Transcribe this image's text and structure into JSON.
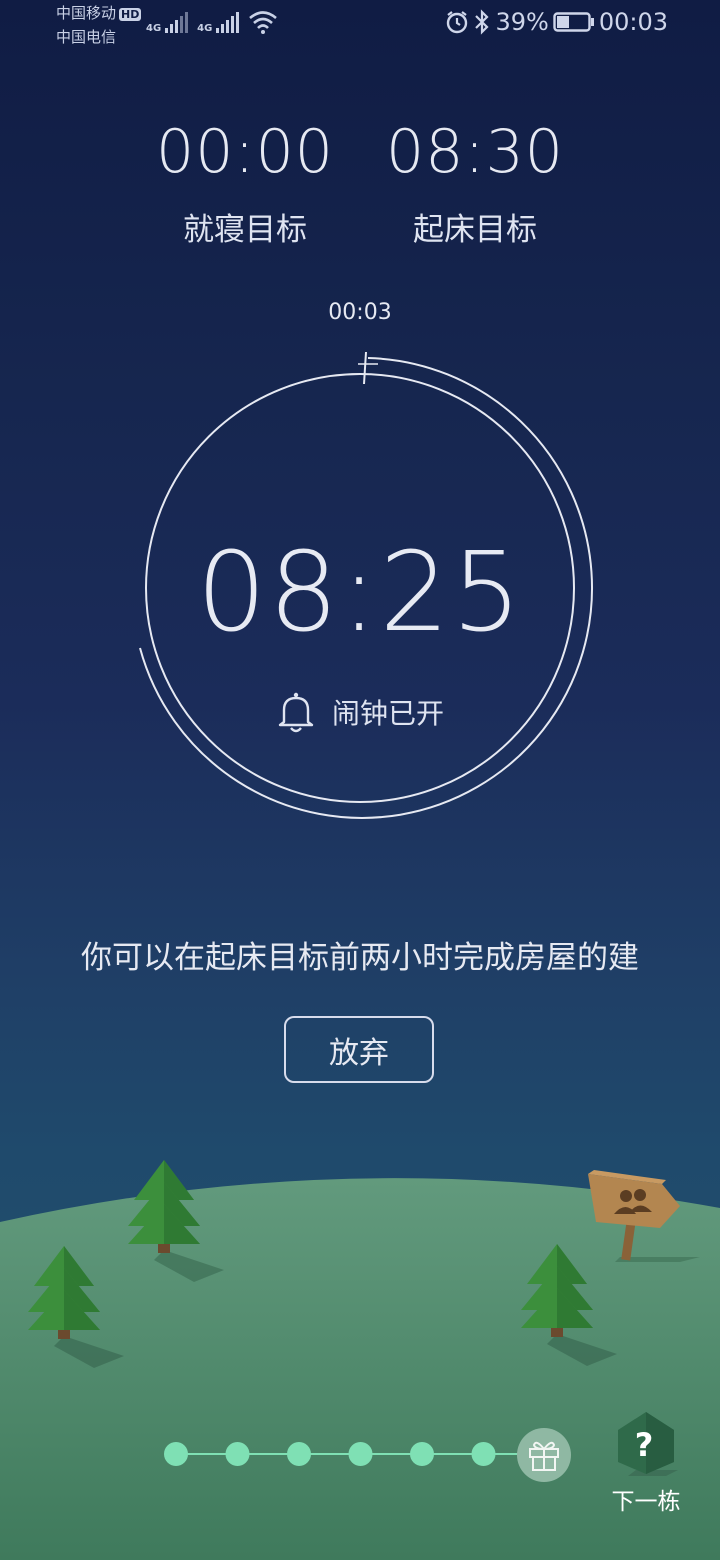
{
  "status_bar": {
    "carrier_1": "中国移动",
    "carrier_1_badge": "HD",
    "carrier_2": "中国电信",
    "network_1": "4G",
    "network_2": "4G",
    "battery_percent": "39%",
    "battery_level": 0.39,
    "time": "00:03",
    "icons": [
      "signal-icon",
      "wifi-icon",
      "alarm-icon",
      "bluetooth-icon",
      "battery-icon"
    ]
  },
  "targets": {
    "sleep": {
      "time": "00:00",
      "label": "就寝目标"
    },
    "wake": {
      "time": "08:30",
      "label": "起床目标"
    }
  },
  "clock": {
    "current_time": "00:03",
    "remaining": "08:25",
    "alarm_label": "闹钟已开",
    "alarm_icon": "bell-icon"
  },
  "hint": "你可以在起床目标前两小时完成房屋的建",
  "actions": {
    "give_up": "放弃",
    "next_label": "下一栋",
    "next_icon": "house-question-icon",
    "social_icon": "people-sign-icon",
    "gift_icon": "gift-icon"
  },
  "progress": {
    "completed_steps": 6,
    "total_steps": 7
  },
  "colors": {
    "sky_top": "#101c44",
    "sky_bottom": "#25546f",
    "hill": "#5c9474",
    "progress_dot": "#7fe0b4"
  }
}
